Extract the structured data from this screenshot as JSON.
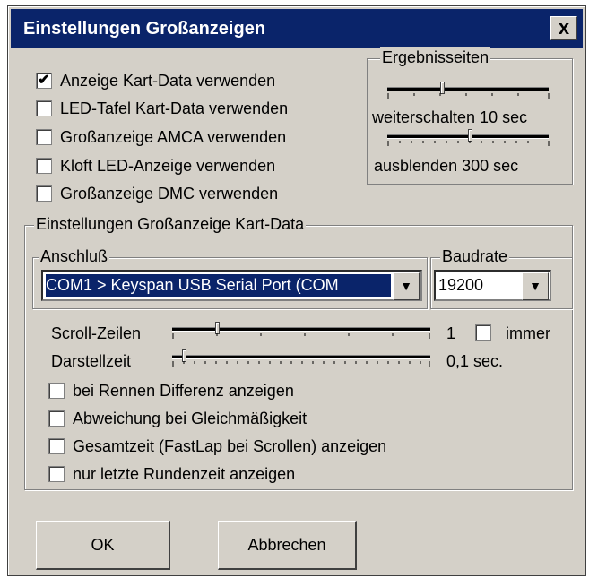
{
  "window": {
    "title": "Einstellungen Großanzeigen",
    "close_label": "x"
  },
  "main_checks": [
    {
      "label": "Anzeige Kart-Data verwenden",
      "checked": true
    },
    {
      "label": "LED-Tafel Kart-Data verwenden",
      "checked": false
    },
    {
      "label": "Großanzeige AMCA verwenden",
      "checked": false
    },
    {
      "label": "Kloft LED-Anzeige verwenden",
      "checked": false
    },
    {
      "label": "Großanzeige DMC verwenden",
      "checked": false
    }
  ],
  "results": {
    "title": "Ergebnisseiten",
    "advance_label": "weiterschalten 10 sec",
    "hide_label": "ausblenden 300 sec"
  },
  "kartdata": {
    "title": "Einstellungen Großanzeige Kart-Data",
    "port_title": "Anschluß",
    "port_value": "COM1 > Keyspan USB Serial Port (COM",
    "baud_title": "Baudrate",
    "baud_value": "19200",
    "scroll_label": "Scroll-Zeilen",
    "scroll_value": "1",
    "always_label": "immer",
    "always_checked": false,
    "display_label": "Darstellzeit",
    "display_value": "0,1 sec.",
    "options": [
      {
        "label": "bei Rennen Differenz anzeigen",
        "checked": false
      },
      {
        "label": "Abweichung bei Gleichmäßigkeit",
        "checked": false
      },
      {
        "label": "Gesamtzeit (FastLap bei Scrollen) anzeigen",
        "checked": false
      },
      {
        "label": "nur letzte Rundenzeit anzeigen",
        "checked": false
      }
    ]
  },
  "buttons": {
    "ok": "OK",
    "cancel": "Abbrechen"
  }
}
